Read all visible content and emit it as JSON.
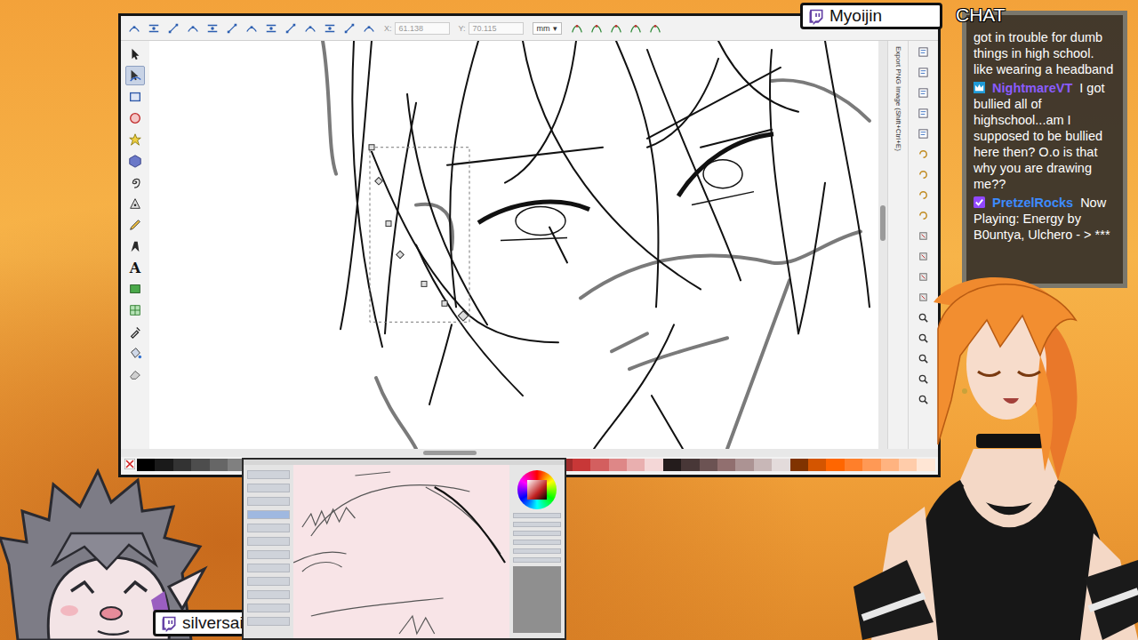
{
  "inkscape": {
    "toolbar": {
      "x_label": "X:",
      "x_value": "61.138",
      "y_label": "Y:",
      "y_value": "70.115",
      "unit": "mm",
      "unit_arrow": "▾"
    },
    "tools": [
      {
        "kind": "selector",
        "selected": false
      },
      {
        "kind": "node",
        "selected": true
      },
      {
        "kind": "rect",
        "selected": false
      },
      {
        "kind": "circle",
        "selected": false
      },
      {
        "kind": "star",
        "selected": false
      },
      {
        "kind": "box3d",
        "selected": false
      },
      {
        "kind": "spiral",
        "selected": false
      },
      {
        "kind": "pen",
        "selected": false
      },
      {
        "kind": "pencil",
        "selected": false
      },
      {
        "kind": "calligraphy",
        "selected": false
      },
      {
        "kind": "text",
        "glyph": "A",
        "selected": false
      },
      {
        "kind": "gradient",
        "selected": false
      },
      {
        "kind": "mesh",
        "selected": false
      },
      {
        "kind": "dropper",
        "selected": false
      },
      {
        "kind": "bucket",
        "selected": false
      },
      {
        "kind": "eraser",
        "selected": false
      }
    ],
    "dock_label": "Export PNG Image (Shift+Ctrl+E)",
    "palette": [
      "#000000",
      "#1a1a1a",
      "#333333",
      "#4d4d4d",
      "#666666",
      "#808080",
      "#999999",
      "#b3b3b3",
      "#cccccc",
      "#e6e6e6",
      "#ffffff",
      "#800000",
      "#aa0000",
      "#d40000",
      "#ff0000",
      "#ff2a2a",
      "#ff5555",
      "#ff8080",
      "#ffaaaa",
      "#ffd5d5",
      "#280b0b",
      "#501616",
      "#782121",
      "#a02c2c",
      "#c83737",
      "#d35f5f",
      "#de8787",
      "#e9afaf",
      "#f4d7d7",
      "#241c1c",
      "#483737",
      "#6c5353",
      "#916f6f",
      "#ac9393",
      "#c8b7b7",
      "#e3dbdb",
      "#803300",
      "#d45500",
      "#ff6600",
      "#ff7f2a",
      "#ff9955",
      "#ffb380",
      "#ffccaa",
      "#ffe6d5"
    ]
  },
  "streamer_tags": {
    "main": "Myoijin",
    "guest": "silversaiho"
  },
  "chat": {
    "title": "CHAT",
    "messages": [
      {
        "badge": "none",
        "text": "got in trouble for dumb things in high school. like wearing a headband"
      },
      {
        "user": "NightmareVT",
        "badge": "crown",
        "color": "#8a5cff",
        "text": "I got bullied all of highschool...am I supposed to be bullied here then? O.o is that why you are drawing me??"
      },
      {
        "user": "PretzelRocks",
        "badge": "check",
        "color": "#3d8bff",
        "text": "Now Playing: Energy by B0untya, Ulchero - > ***"
      }
    ]
  }
}
